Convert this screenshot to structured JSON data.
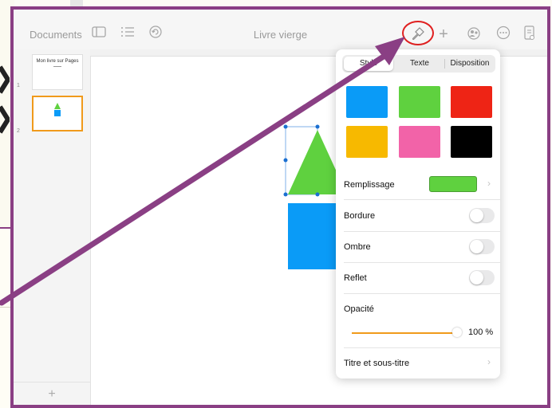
{
  "toolbar": {
    "documents_label": "Documents",
    "title": "Livre vierge"
  },
  "sidebar": {
    "pages": [
      {
        "number": "1",
        "title": "Mon livre sur Pages"
      },
      {
        "number": "2",
        "title": ""
      }
    ],
    "add_label": "+"
  },
  "panel": {
    "tabs": [
      {
        "label": "Style",
        "selected": true
      },
      {
        "label": "Texte",
        "selected": false
      },
      {
        "label": "Disposition",
        "selected": false
      }
    ],
    "swatches": [
      "#0a9bf7",
      "#5fd13f",
      "#ee2415",
      "#f7b900",
      "#f263a8",
      "#000000"
    ],
    "fill_label": "Remplissage",
    "fill_color": "#5fd13f",
    "border_label": "Bordure",
    "border_on": false,
    "shadow_label": "Ombre",
    "shadow_on": false,
    "reflection_label": "Reflet",
    "reflection_on": false,
    "opacity_label": "Opacité",
    "opacity_value": "100 %",
    "opacity_level": 1.0,
    "title_label": "Titre et sous-titre"
  },
  "colors": {
    "accent": "#f09a1b",
    "frame": "#8a3f84",
    "highlight": "#e02020",
    "triangle": "#5fd13f",
    "rectangle": "#0a9bf7"
  }
}
